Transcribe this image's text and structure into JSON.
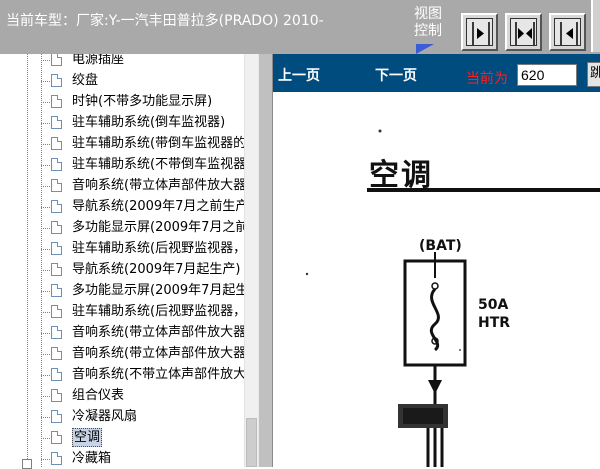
{
  "header": {
    "vehicle_info": "当前车型：厂家:Y-一汽丰田普拉多(PRADO) 2010-",
    "view_control_line1": "视图",
    "view_control_line2": "控制"
  },
  "view_buttons": [
    {
      "icon": "dock-right-arrow-icon"
    },
    {
      "icon": "split-view-icon"
    },
    {
      "icon": "dock-left-arrow-icon"
    }
  ],
  "tree": {
    "items": [
      {
        "label": "电源插座"
      },
      {
        "label": "绞盘"
      },
      {
        "label": "时钟(不带多功能显示屏)"
      },
      {
        "label": "驻车辅助系统(倒车监视器)"
      },
      {
        "label": "驻车辅助系统(带倒车监视器的"
      },
      {
        "label": "驻车辅助系统(不带倒车监视器"
      },
      {
        "label": "音响系统(带立体声部件放大器"
      },
      {
        "label": "导航系统(2009年7月之前生产"
      },
      {
        "label": "多功能显示屏(2009年7月之前"
      },
      {
        "label": "驻车辅助系统(后视野监视器，"
      },
      {
        "label": "导航系统(2009年7月起生产)"
      },
      {
        "label": "多功能显示屏(2009年7月起生"
      },
      {
        "label": "驻车辅助系统(后视野监视器，"
      },
      {
        "label": "音响系统(带立体声部件放大器"
      },
      {
        "label": "音响系统(带立体声部件放大器"
      },
      {
        "label": "音响系统(不带立体声部件放大"
      },
      {
        "label": "组合仪表"
      },
      {
        "label": "冷凝器风扇"
      },
      {
        "label": "空调",
        "selected": true
      },
      {
        "label": "冷藏箱"
      }
    ]
  },
  "nav": {
    "prev_label": "上一页",
    "next_label": "下一页",
    "current_label": "当前为",
    "current_page": "620",
    "go_label": "跳"
  },
  "document": {
    "title": "空调",
    "bat_label": "(BAT)",
    "fuse_rating": "50A",
    "fuse_name": "HTR"
  },
  "colors": {
    "topbar": "#a9a9a9",
    "navbar": "#004c7e",
    "page_label": "#ff1e1e",
    "selected_item": "#c8d4e6"
  }
}
